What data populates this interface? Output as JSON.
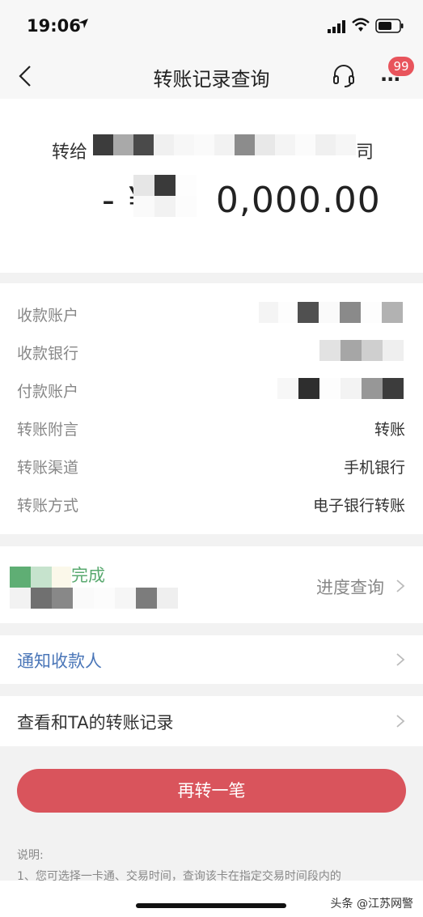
{
  "status_bar": {
    "time": "19:06"
  },
  "nav": {
    "title": "转账记录查询",
    "badge": "99",
    "more_label": "···"
  },
  "summary": {
    "to_prefix": "转给",
    "to_suffix": "司",
    "amount_prefix": "- ¥",
    "amount_suffix": "0,000.00"
  },
  "details": [
    {
      "label": "收款账户",
      "value": ""
    },
    {
      "label": "收款银行",
      "value": ""
    },
    {
      "label": "付款账户",
      "value": ""
    },
    {
      "label": "转账附言",
      "value": "转账"
    },
    {
      "label": "转账渠道",
      "value": "手机银行"
    },
    {
      "label": "转账方式",
      "value": "电子银行转账"
    }
  ],
  "progress": {
    "status": "完成",
    "link": "进度查询"
  },
  "notify": {
    "label": "通知收款人"
  },
  "history": {
    "label": "查看和TA的转账记录"
  },
  "actions": {
    "again": "再转一笔"
  },
  "note": {
    "title": "说明:",
    "text": "1、您可选择一卡通、交易时间，查询该卡在指定交易时间段内的"
  },
  "watermark": "头条 @江苏网警",
  "colors": {
    "accent": "#d9545c",
    "link": "#4a76b8",
    "success": "#59a96f"
  }
}
